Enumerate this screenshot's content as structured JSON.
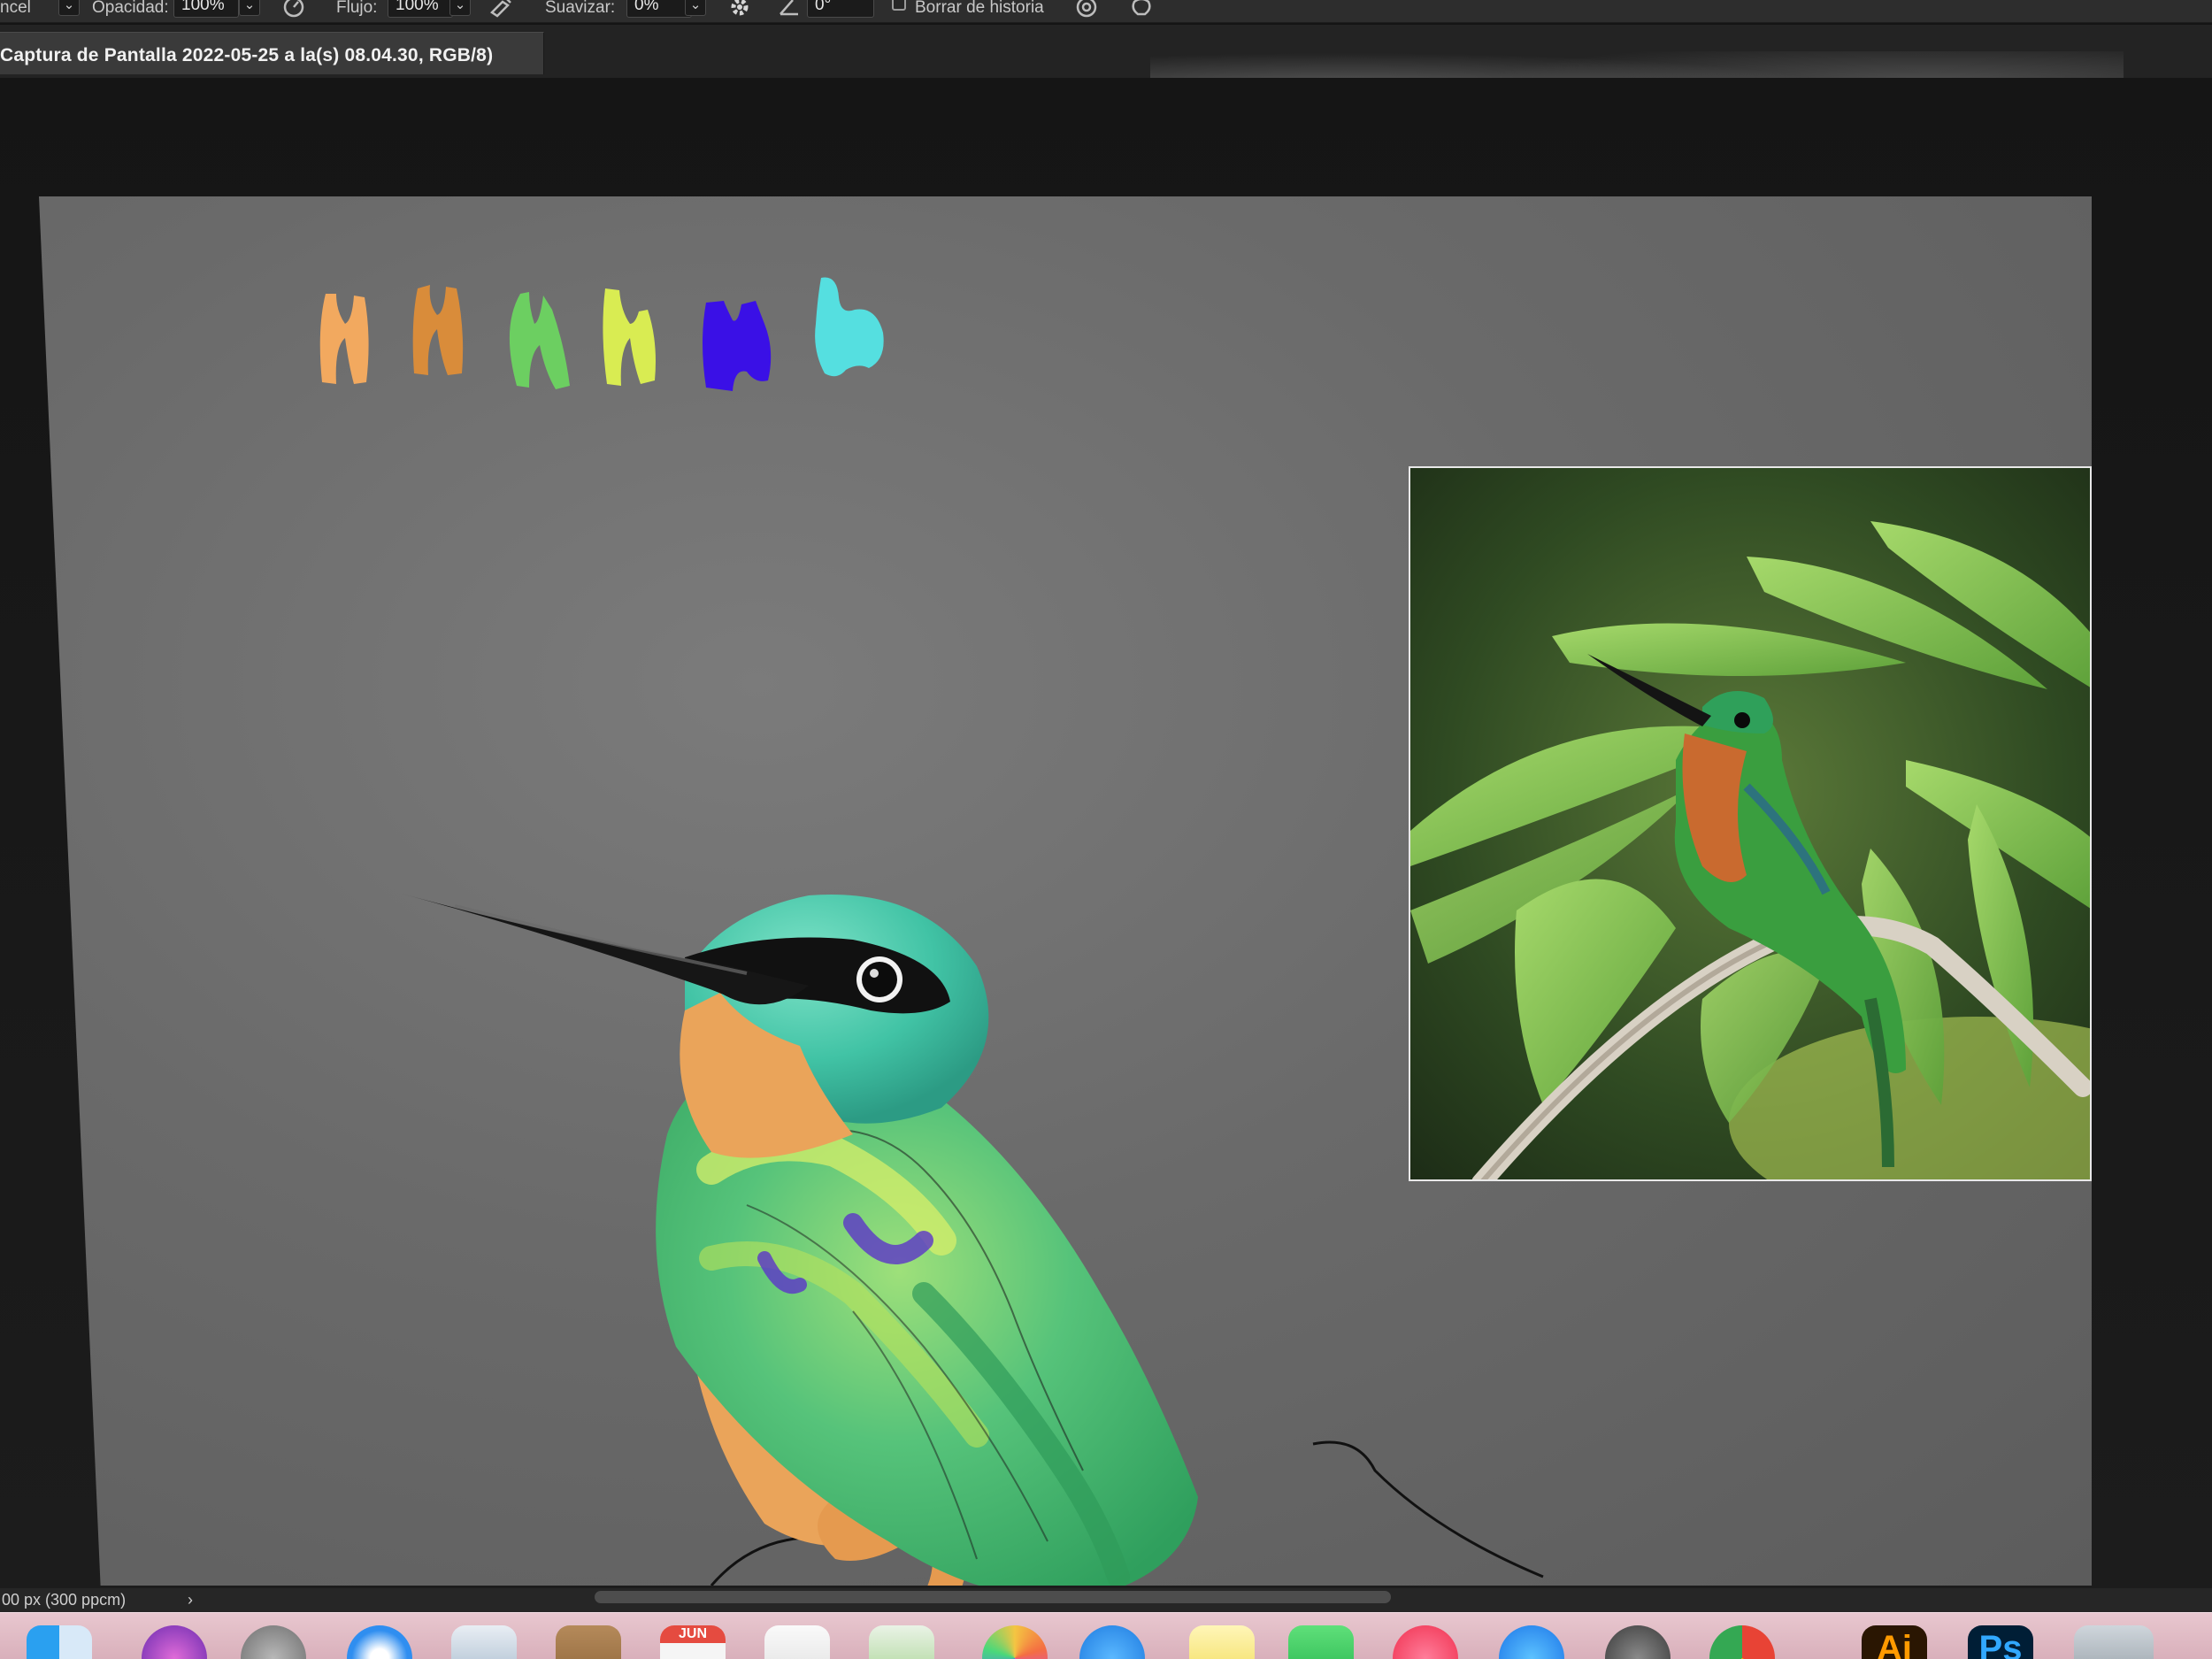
{
  "options_bar": {
    "brush_label": "ncel",
    "opacity_label": "Opacidad:",
    "opacity_value": "100%",
    "flow_label": "Flujo:",
    "flow_value": "100%",
    "smoothing_label": "Suavizar:",
    "smoothing_value": "0%",
    "angle_value": "0°",
    "erase_history_label": "Borrar de historia"
  },
  "document_tab": {
    "title": "Captura de Pantalla 2022-05-25 a la(s) 08.04.30, RGB/8)"
  },
  "canvas": {
    "swatch_colors": [
      "#f2a95f",
      "#d98c3a",
      "#6ccf61",
      "#d9ec52",
      "#3a10e6",
      "#55dfe0"
    ]
  },
  "status_bar": {
    "document_info": "00 px (300 ppcm)",
    "arrow": "›"
  },
  "dock": {
    "calendar_month": "JUN",
    "illustrator_label": "Ai",
    "photoshop_label": "Ps"
  }
}
